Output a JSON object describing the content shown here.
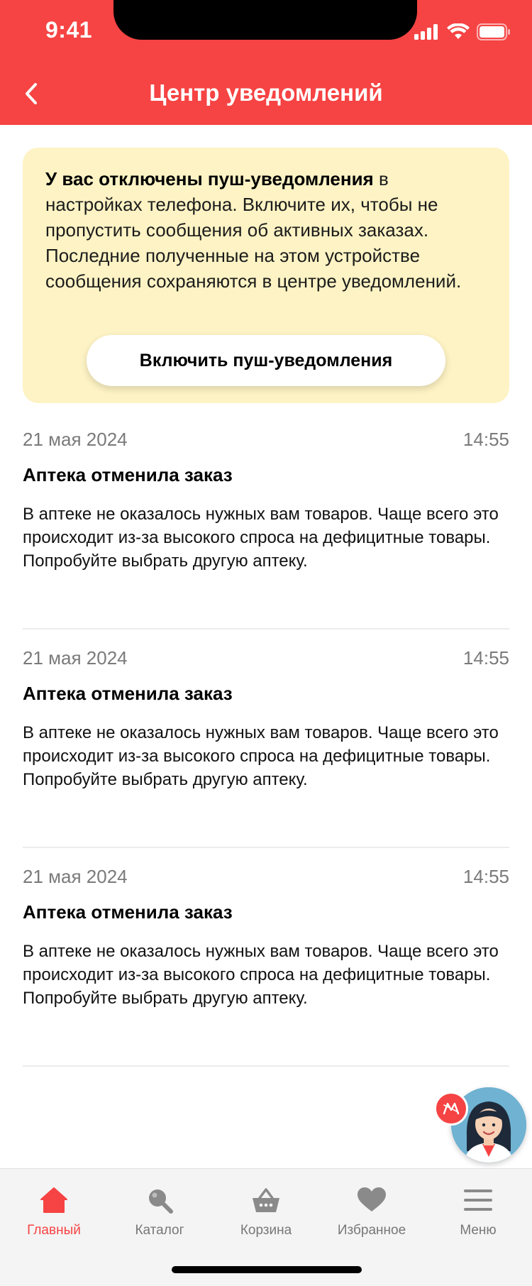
{
  "status_bar": {
    "time": "9:41"
  },
  "header": {
    "title": "Центр уведомлений"
  },
  "banner": {
    "bold_text": "У вас отключены пуш-уведомления",
    "text": " в настройках телефона. Включите их, чтобы не пропустить сообщения об активных заказах. Последние полученные на этом устройстве сообщения сохраняются в центре уведомлений.",
    "button_label": "Включить пуш-уведомления"
  },
  "notifications": [
    {
      "date": "21 мая 2024",
      "time": "14:55",
      "title": "Аптека отменила заказ",
      "body": "В аптеке не оказалось нужных вам товаров. Чаще всего это происходит из-за высокого спроса на дефицитные товары. Попробуйте выбрать другую аптеку."
    },
    {
      "date": "21 мая 2024",
      "time": "14:55",
      "title": "Аптека отменила заказ",
      "body": "В аптеке не оказалось нужных вам товаров. Чаще всего это происходит из-за высокого спроса на дефицитные товары. Попробуйте выбрать другую аптеку."
    },
    {
      "date": "21 мая 2024",
      "time": "14:55",
      "title": "Аптека отменила заказ",
      "body": "В аптеке не оказалось нужных вам товаров. Чаще всего это происходит из-за высокого спроса на дефицитные товары. Попробуйте выбрать другую аптеку."
    }
  ],
  "bottom_nav": {
    "items": [
      {
        "label": "Главный",
        "icon": "home-icon",
        "active": true
      },
      {
        "label": "Каталог",
        "icon": "search-icon",
        "active": false
      },
      {
        "label": "Корзина",
        "icon": "basket-icon",
        "active": false
      },
      {
        "label": "Избранное",
        "icon": "heart-icon",
        "active": false
      },
      {
        "label": "Меню",
        "icon": "menu-icon",
        "active": false
      }
    ]
  },
  "colors": {
    "brand_red": "#F64343",
    "banner_bg": "#FDF3C4",
    "muted_text": "#7A7A7A",
    "nav_bg": "#F4F4F4"
  }
}
